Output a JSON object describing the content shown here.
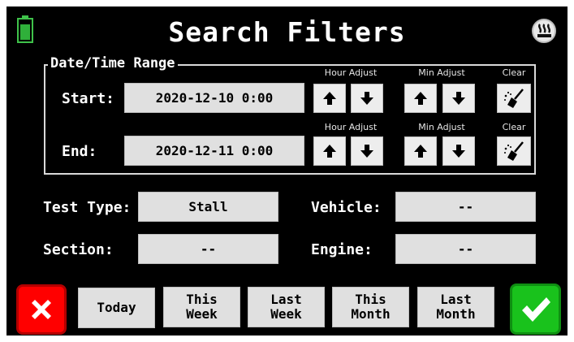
{
  "header": {
    "title": "Search Filters",
    "battery_icon": "battery-icon",
    "heater_icon": "heater-icon"
  },
  "date_time_range": {
    "legend": "Date/Time Range",
    "start": {
      "label": "Start:",
      "value": "2020-12-10 0:00",
      "hour_adjust_label": "Hour Adjust",
      "min_adjust_label": "Min Adjust",
      "clear_label": "Clear"
    },
    "end": {
      "label": "End:",
      "value": "2020-12-11 0:00",
      "hour_adjust_label": "Hour Adjust",
      "min_adjust_label": "Min Adjust",
      "clear_label": "Clear"
    }
  },
  "filters": {
    "test_type": {
      "label": "Test Type:",
      "value": "Stall"
    },
    "vehicle": {
      "label": "Vehicle:",
      "value": "--"
    },
    "section": {
      "label": "Section:",
      "value": "--"
    },
    "engine": {
      "label": "Engine:",
      "value": "--"
    }
  },
  "quick_range": {
    "today": "Today",
    "this_week": "This\nWeek",
    "last_week": "Last\nWeek",
    "this_month": "This\nMonth",
    "last_month": "Last\nMonth"
  },
  "colors": {
    "background": "#000000",
    "field": "#e0e0e0",
    "cancel": "#ff0000",
    "confirm": "#19c21c",
    "battery": "#3fc24a"
  }
}
